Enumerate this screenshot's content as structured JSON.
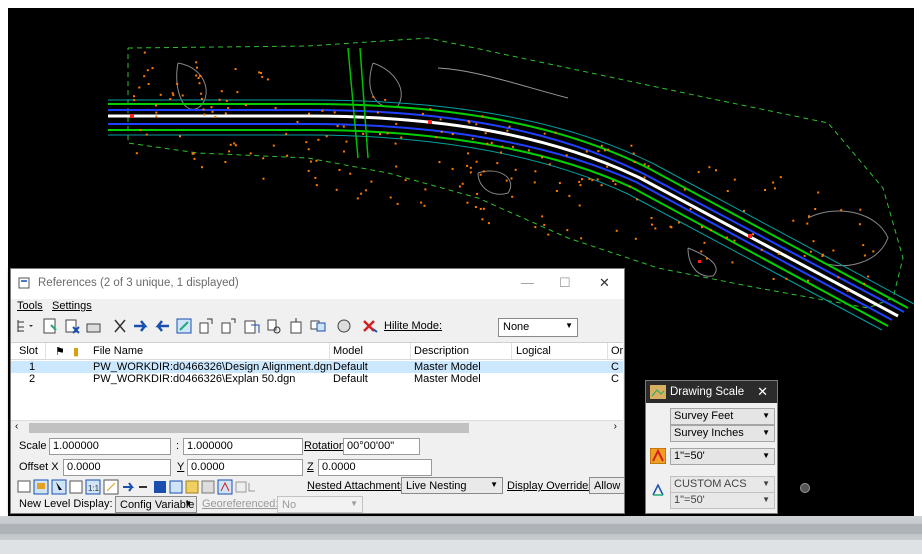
{
  "references": {
    "title": "References (2 of 3 unique, 1 displayed)",
    "menu": [
      "Tools",
      "Settings"
    ],
    "hilite_mode_label": "Hilite Mode:",
    "hilite_mode_value": "None",
    "columns": [
      "Slot",
      "File Name",
      "Model",
      "Description",
      "Logical",
      "Or"
    ],
    "rows": [
      {
        "slot": "1",
        "file": "PW_WORKDIR:d0466326\\Design Alignment.dgn",
        "model": "Default",
        "description": "Master Model",
        "logical": "",
        "or": "C"
      },
      {
        "slot": "2",
        "file": "PW_WORKDIR:d0466326\\Explan 50.dgn",
        "model": "Default",
        "description": "Master Model",
        "logical": "",
        "or": "C"
      }
    ],
    "scale_label": "Scale",
    "scale_value1": "1.000000",
    "scale_sep": ":",
    "scale_value2": "1.000000",
    "rotation_label": "Rotation",
    "rotation_value": "00°00'00\"",
    "offset_label": "Offset X",
    "offset_x": "0.0000",
    "y_label": "Y",
    "offset_y": "0.0000",
    "z_label": "Z",
    "offset_z": "0.0000",
    "nested_label": "Nested Attachments:",
    "nested_value": "Live Nesting",
    "display_overrides_label": "Display Overrides:",
    "display_overrides_value": "Allow",
    "new_level_label": "New Level Display:",
    "new_level_value": "Config Variable",
    "georeferenced_label": "Georeferenced:",
    "georeferenced_value": "No"
  },
  "drawing_scale": {
    "title": "Drawing Scale",
    "unit1": "Survey Feet",
    "unit2": "Survey Inches",
    "scale": "1\"=50'",
    "acs": "CUSTOM ACS",
    "acs_scale": "1\"=50'"
  },
  "colors": {
    "canvas_bg": "#000000",
    "selected_row": "#cce8ff",
    "boundary_dashed": "#2fbf2f",
    "points": "#ff7a00",
    "road_green": "#00d000",
    "road_blue": "#2040ff"
  }
}
